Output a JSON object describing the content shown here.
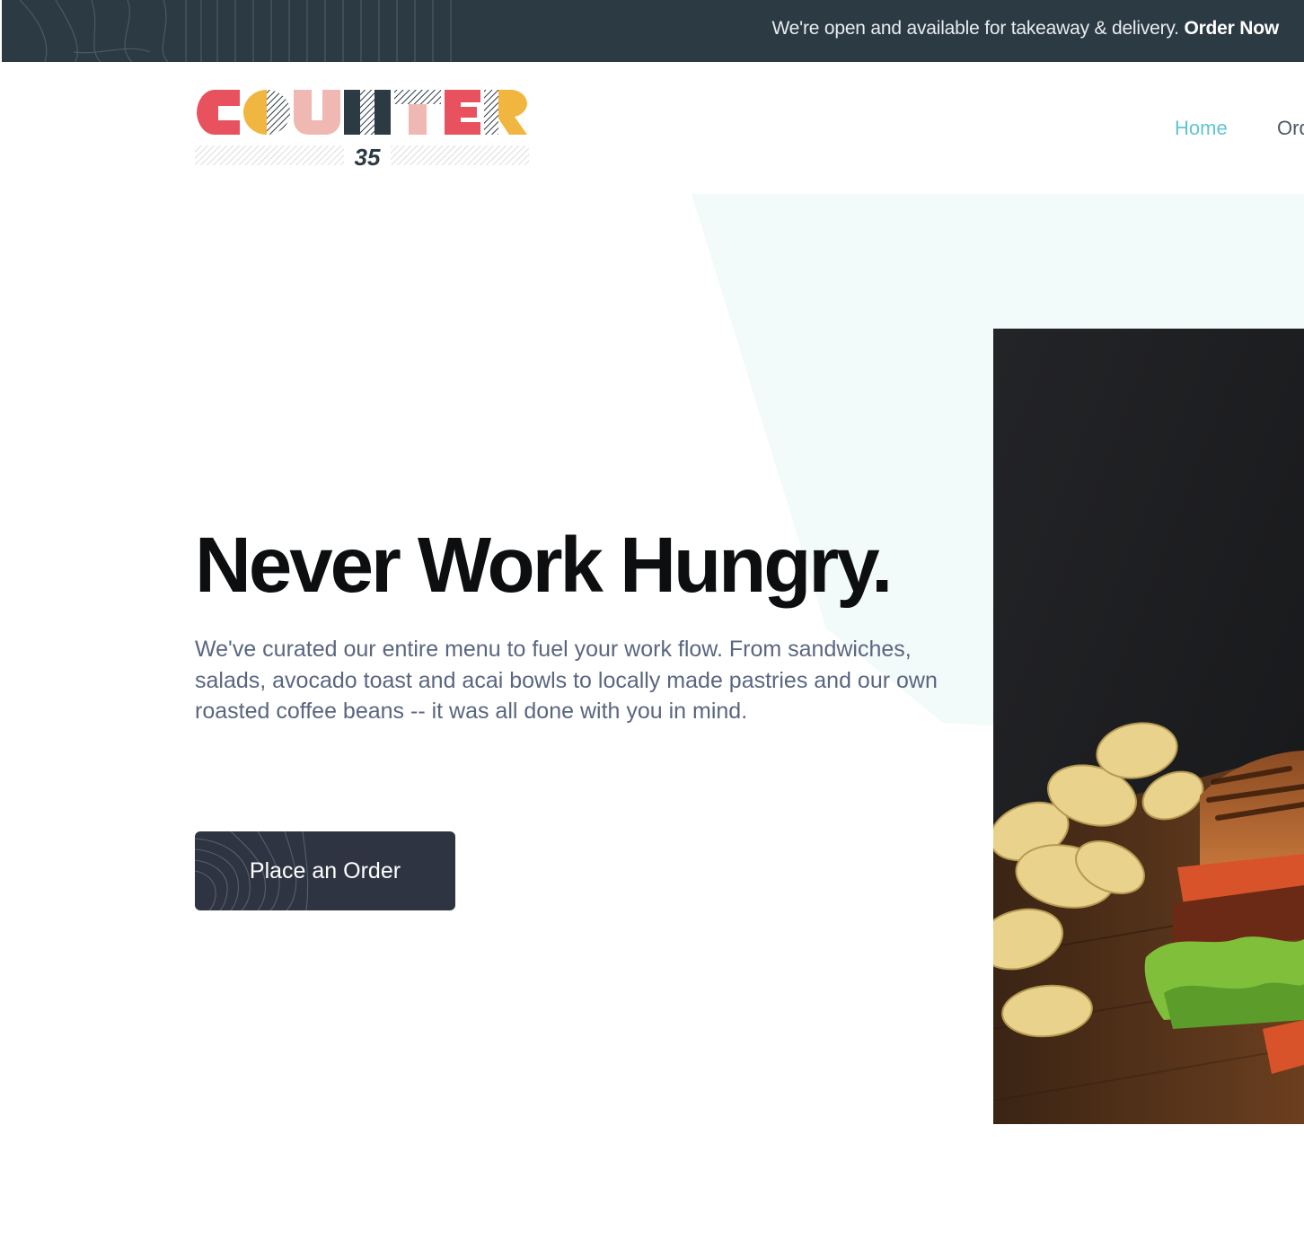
{
  "announcement": {
    "text": "We're open and available for takeaway & delivery.",
    "link_label": "Order Now"
  },
  "logo": {
    "wordmark": "COUNTER",
    "number": "35"
  },
  "nav": {
    "items": [
      {
        "label": "Home"
      },
      {
        "label": "Order"
      }
    ]
  },
  "hero": {
    "title": "Never Work Hungry.",
    "description": "We've curated our entire menu to fuel your work flow. From sandwiches, salads, avocado toast and acai bowls to locally made pastries and our own roasted coffee beans -- it was all done with you in mind.",
    "cta_label": "Place an Order"
  },
  "colors": {
    "topbar": "#2c3a44",
    "nav_active": "#5fc5cf",
    "title": "#0c0e10",
    "body_text": "#5a6680",
    "cta": "#2e3442",
    "hero_bg_shape": "#f3fafa",
    "logo_red": "#e8525f",
    "logo_yellow": "#f0b63f",
    "logo_pink": "#efb8b2",
    "logo_navy": "#2c3a44"
  }
}
